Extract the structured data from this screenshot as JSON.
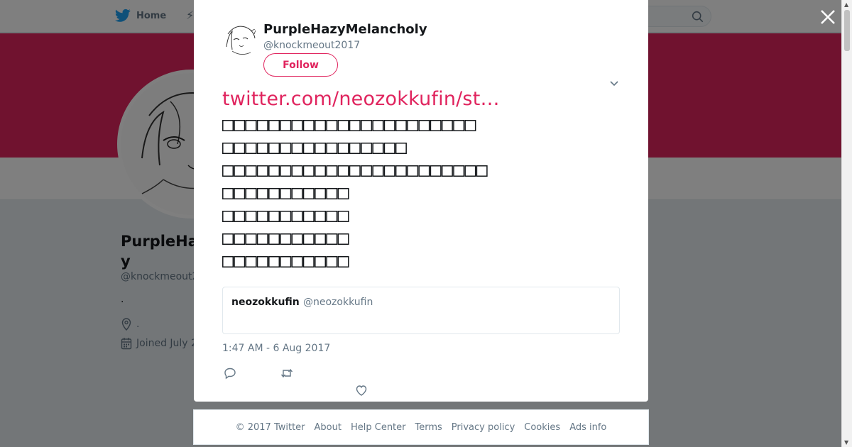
{
  "topbar": {
    "home_label": "Home"
  },
  "background_profile": {
    "name_fragment": "PurpleHa\ny",
    "handle_fragment": "@knockmeout2",
    "bio": ".",
    "location": ".",
    "joined_fragment": "Joined July 2"
  },
  "tweet": {
    "display_name": "PurpleHazyMelancholy",
    "handle": "@knockmeout2017",
    "follow_label": "Follow",
    "link_text": "twitter.com/neozokkufin/st…",
    "lines": [
      "□□□□□□□□□□□□□□□□□□□□□□",
      "□□□□□□□□□□□□□□□□",
      "□□□□□□□□□□□□□□□□□□□□□□□",
      "□□□□□□□□□□□",
      "□□□□□□□□□□□",
      "□□□□□□□□□□□",
      "□□□□□□□□□□□"
    ],
    "quote": {
      "name": "neozokkufin",
      "handle": "@neozokkufin"
    },
    "timestamp": "1:47 AM - 6 Aug 2017"
  },
  "footer": {
    "links": [
      "© 2017 Twitter",
      "About",
      "Help Center",
      "Terms",
      "Privacy policy",
      "Cookies",
      "Ads info"
    ]
  },
  "colors": {
    "accent": "#e0245e",
    "twitter_blue": "#1da1f2",
    "muted": "#657786"
  },
  "icons": [
    "twitter-bird-icon",
    "search-icon",
    "close-icon",
    "chevron-down-icon",
    "reply-icon",
    "retweet-icon",
    "like-icon",
    "location-icon",
    "calendar-icon"
  ]
}
